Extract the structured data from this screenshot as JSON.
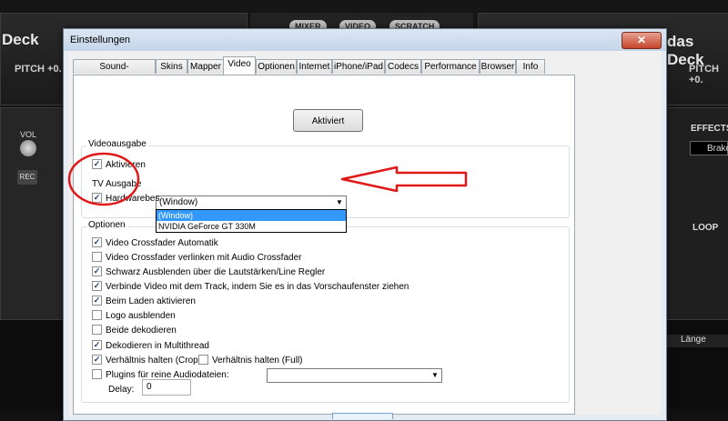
{
  "background": {
    "left_deck_title": "Deck",
    "right_deck_title": "das Deck",
    "left_pitch": "PITCH +0.",
    "right_pitch": "PITCH +0.",
    "top_tabs": [
      "MIXER",
      "VIDEO",
      "SCRATCH"
    ],
    "vol_label": "VOL",
    "rec_label": "REC",
    "effects_label": "EFFECTS",
    "effects_value": "Brake",
    "loop_label": "LOOP",
    "length_header": "Länge"
  },
  "dialog": {
    "title": "Einstellungen",
    "close_glyph": "✕",
    "tabs": [
      "Sound-Einstellungen",
      "Skins",
      "Mapper",
      "Video",
      "Optionen",
      "Internet",
      "iPhone/iPad",
      "Codecs",
      "Performance",
      "Browser",
      "Info"
    ],
    "active_tab": "Video",
    "aktiviert_button": "Aktiviert",
    "videoausgabe": {
      "group_label": "Videoausgabe",
      "aktivieren": "Aktivieren",
      "tv_ausgabe_label": "TV Ausgabe",
      "tv_ausgabe_value": "(Window)",
      "hardware_label": "Hardwarebes",
      "dropdown_options": [
        "(Window)",
        "NVIDIA GeForce GT 330M"
      ]
    },
    "optionen": {
      "group_label": "Optionen",
      "items": [
        {
          "label": "Video Crossfader Automatik",
          "checked": true
        },
        {
          "label": "Video Crossfader verlinken mit Audio Crossfader",
          "checked": false
        },
        {
          "label": "Schwarz Ausblenden über die Lautstärken/Line Regler",
          "checked": true
        },
        {
          "label": "Verbinde Video mit dem Track, indem Sie es in das Vorschaufenster ziehen",
          "checked": true
        },
        {
          "label": "Beim Laden aktivieren",
          "checked": true
        },
        {
          "label": "Logo ausblenden",
          "checked": false
        },
        {
          "label": "Beide dekodieren",
          "checked": false
        },
        {
          "label": "Dekodieren in Multithread",
          "checked": true
        },
        {
          "label": "Verhältnis halten (Crop)",
          "checked": true
        },
        {
          "label": "Plugins für reine Audiodateien:",
          "checked": false
        }
      ],
      "verhaeltnis_full": "Verhältnis halten (Full)",
      "delay_label": "Delay:",
      "delay_value": "0",
      "check_glyph": "✓"
    }
  }
}
